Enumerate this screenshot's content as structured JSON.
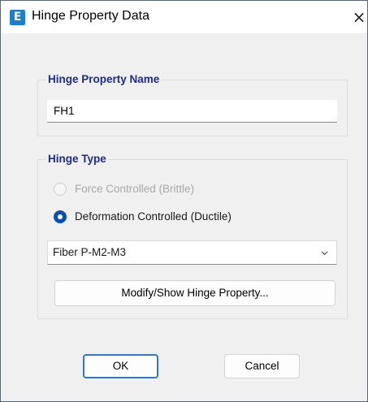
{
  "window": {
    "title": "Hinge Property Data",
    "app_icon_letter": "E",
    "close_glyph": "×",
    "colors": {
      "accent": "#0a4fb3",
      "group_label": "#1c2a9c",
      "app_icon": "#1a7fd4"
    }
  },
  "hinge_property_name": {
    "group_label": "Hinge Property Name",
    "value": "FH1"
  },
  "hinge_type": {
    "group_label": "Hinge Type",
    "options": [
      {
        "label": "Force Controlled  (Brittle)",
        "checked": false,
        "enabled": false
      },
      {
        "label": "Deformation Controlled  (Ductile)",
        "checked": true,
        "enabled": true
      }
    ],
    "select_value": "Fiber P-M2-M3",
    "modify_button_label": "Modify/Show Hinge Property..."
  },
  "footer": {
    "ok_label": "OK",
    "cancel_label": "Cancel"
  }
}
